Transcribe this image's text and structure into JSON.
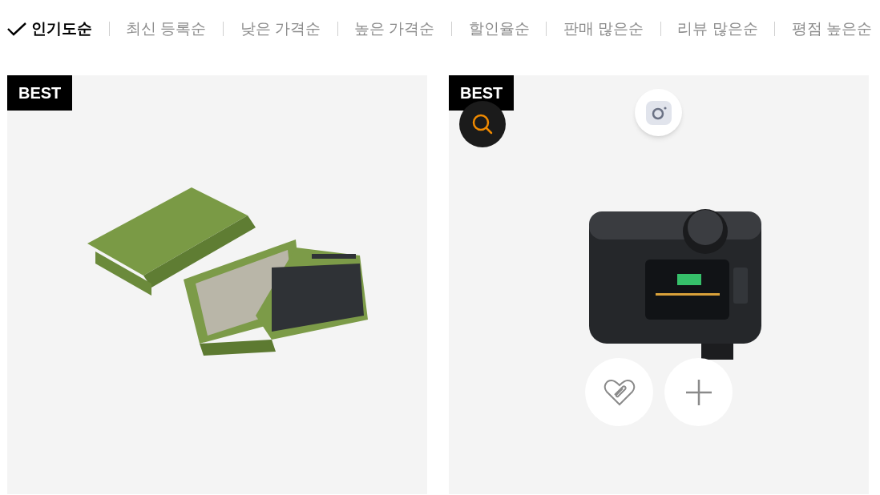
{
  "sort_options": [
    {
      "label": "인기도순",
      "selected": true
    },
    {
      "label": "최신 등록순",
      "selected": false
    },
    {
      "label": "낮은 가격순",
      "selected": false
    },
    {
      "label": "높은 가격순",
      "selected": false
    },
    {
      "label": "할인율순",
      "selected": false
    },
    {
      "label": "판매 많은순",
      "selected": false
    },
    {
      "label": "리뷰 많은순",
      "selected": false
    },
    {
      "label": "평점 높은순",
      "selected": false
    }
  ],
  "products": [
    {
      "badge": "BEST",
      "kind": "keyboard",
      "hovered": false
    },
    {
      "badge": "BEST",
      "kind": "camera",
      "hovered": true
    }
  ]
}
